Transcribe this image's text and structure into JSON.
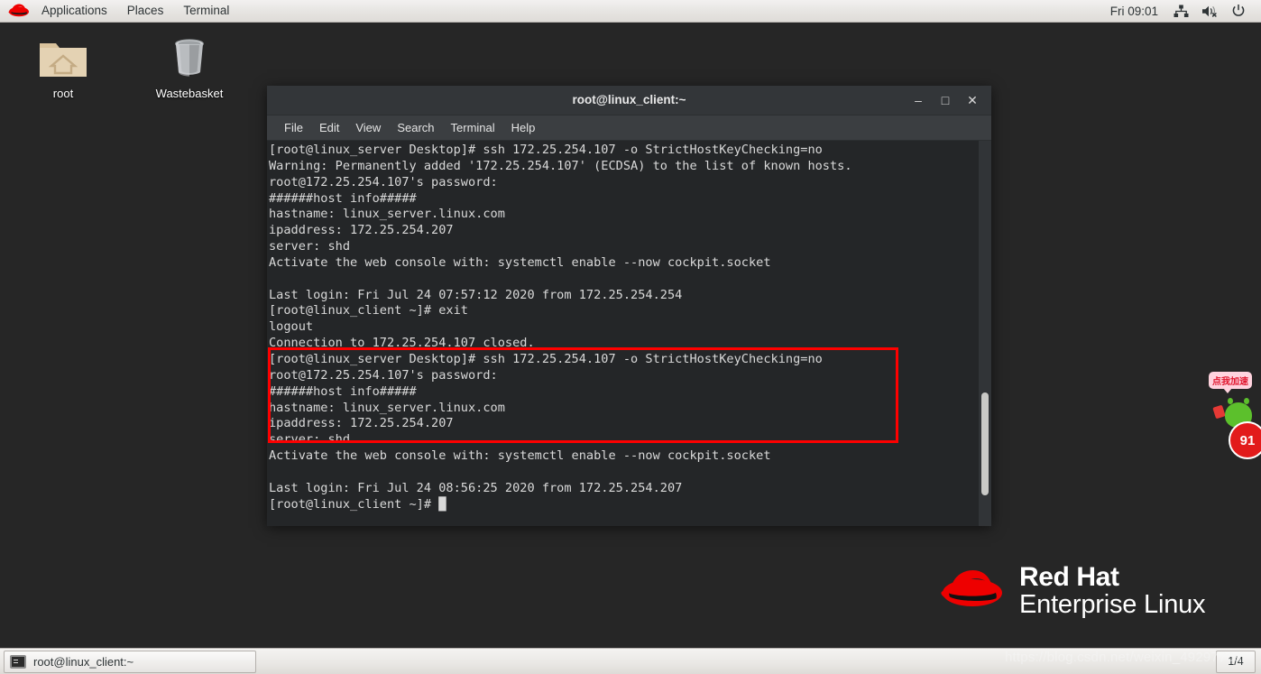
{
  "top_panel": {
    "logo_icon": "redhat-logo-icon",
    "menus": [
      {
        "label": "Applications",
        "name": "applications-menu"
      },
      {
        "label": "Places",
        "name": "places-menu"
      },
      {
        "label": "Terminal",
        "name": "terminal-menu"
      }
    ],
    "clock": "Fri 09:01",
    "tray": [
      {
        "name": "network-icon"
      },
      {
        "name": "volume-muted-icon"
      },
      {
        "name": "power-icon"
      }
    ]
  },
  "desktop": {
    "icons": [
      {
        "label": "root",
        "icon": "home-folder-icon",
        "name": "desktop-icon-root"
      },
      {
        "label": "Wastebasket",
        "icon": "trash-icon",
        "name": "desktop-icon-wastebasket"
      }
    ]
  },
  "terminal": {
    "title": "root@linux_client:~",
    "window_buttons": [
      {
        "label": "–",
        "name": "minimize-button"
      },
      {
        "label": "□",
        "name": "maximize-button"
      },
      {
        "label": "✕",
        "name": "close-button"
      }
    ],
    "menu": [
      {
        "label": "File",
        "name": "menu-file"
      },
      {
        "label": "Edit",
        "name": "menu-edit"
      },
      {
        "label": "View",
        "name": "menu-view"
      },
      {
        "label": "Search",
        "name": "menu-search"
      },
      {
        "label": "Terminal",
        "name": "menu-terminal"
      },
      {
        "label": "Help",
        "name": "menu-help"
      }
    ],
    "content": "[root@linux_server Desktop]# ssh 172.25.254.107 -o StrictHostKeyChecking=no\nWarning: Permanently added '172.25.254.107' (ECDSA) to the list of known hosts.\nroot@172.25.254.107's password:\n######host info#####\nhastname: linux_server.linux.com\nipaddress: 172.25.254.207\nserver: shd\nActivate the web console with: systemctl enable --now cockpit.socket\n\nLast login: Fri Jul 24 07:57:12 2020 from 172.25.254.254\n[root@linux_client ~]# exit\nlogout\nConnection to 172.25.254.107 closed.\n[root@linux_server Desktop]# ssh 172.25.254.107 -o StrictHostKeyChecking=no\nroot@172.25.254.107's password:\n######host info#####\nhastname: linux_server.linux.com\nipaddress: 172.25.254.207\nserver: shd\nActivate the web console with: systemctl enable --now cockpit.socket\n\nLast login: Fri Jul 24 08:56:25 2020 from 172.25.254.207\n[root@linux_client ~]# █"
  },
  "annotation": {
    "color": "#fe0000",
    "name": "red-highlight-box"
  },
  "watermark": {
    "brand_line1": "Red Hat",
    "brand_line2": "Enterprise Linux",
    "csdn_url": "https://blog.csdn.net/weixin_49297769"
  },
  "bottom_panel": {
    "task_button_label": "root@linux_client:~",
    "task_button_icon": "terminal-icon",
    "workspace": "1/4"
  },
  "ad_widget": {
    "bubble_text": "点我加速",
    "badge_text": "91",
    "mascot_icon": "green-mascot-icon"
  },
  "colors": {
    "desktop_bg": "#262626",
    "terminal_bg": "#242628",
    "accent_red": "#ee0000",
    "annotation_red": "#fe0000"
  }
}
